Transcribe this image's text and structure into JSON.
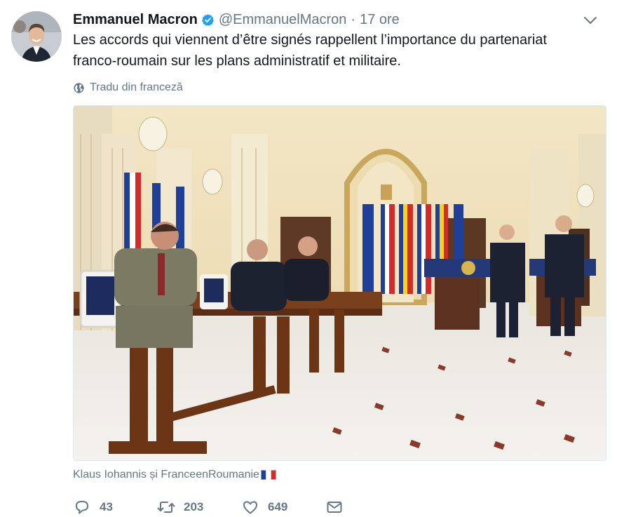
{
  "tweet": {
    "author_name": "Emmanuel Macron",
    "handle": "@EmmanuelMacron",
    "separator": "·",
    "time": "17 ore",
    "text": "Les accords qui viennent d’être signés rappellent l’importance du partenariat franco-roumain sur les plans administratif et militaire.",
    "translate_label": "Tradu din franceză",
    "tagged_people": "Klaus Iohannis și FranceenRoumanie",
    "counts": {
      "replies": "43",
      "retweets": "203",
      "likes": "649"
    }
  },
  "icons": {
    "verified": "verified-badge-icon",
    "caret": "chevron-down-icon",
    "globe": "globe-icon",
    "flag": "french-flag-icon",
    "reply": "reply-icon",
    "retweet": "retweet-icon",
    "like": "heart-icon",
    "dm": "envelope-icon"
  },
  "colors": {
    "text": "#14171a",
    "secondary": "#657786",
    "verified_blue": "#1da1f2",
    "border": "#e1e8ed"
  }
}
